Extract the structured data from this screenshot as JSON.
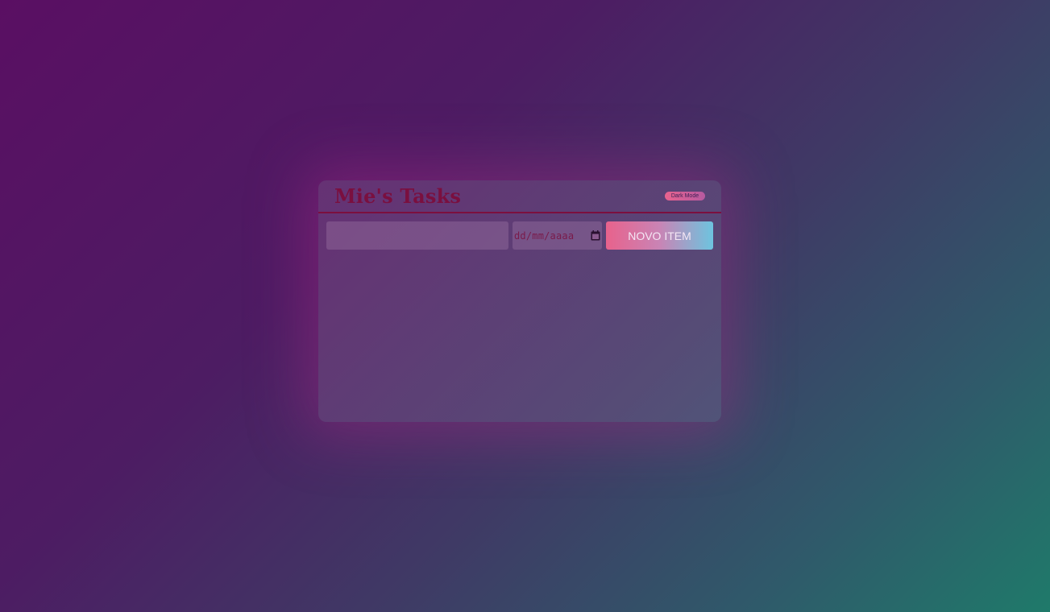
{
  "app": {
    "title": "Mie's Tasks",
    "dark_mode_label": "Dark Mode"
  },
  "form": {
    "task_value": "",
    "task_placeholder": "",
    "date_placeholder": "dd/mm/aaaa",
    "date_icon": "calendar-icon",
    "submit_label": "NOVO ITEM"
  },
  "tasks": [],
  "colors": {
    "title": "#7a0f3f",
    "header_border": "#7c0f3e",
    "button_gradient_start": "#e8628c",
    "button_gradient_end": "#6dc4df",
    "background_start": "#5a0f63",
    "background_end": "#1f7a6a"
  }
}
